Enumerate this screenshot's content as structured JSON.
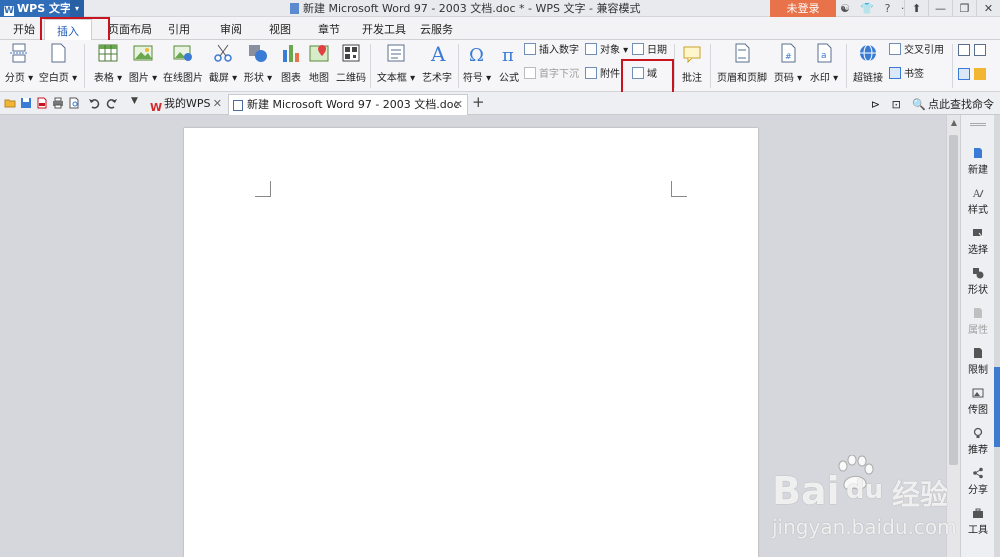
{
  "titlebar": {
    "app_name": "WPS 文字",
    "app_caret": "▾",
    "doc_title": "新建 Microsoft Word 97 - 2003 文档.doc * - WPS 文字 - 兼容模式",
    "login": "未登录",
    "tools": [
      "☯",
      "👕",
      "?",
      "·"
    ],
    "window_controls": [
      "⬆",
      "—",
      "❐",
      "✕"
    ]
  },
  "menu": {
    "tabs": [
      "开始",
      "插入",
      "页面布局",
      "引用",
      "审阅",
      "视图",
      "章节",
      "开发工具",
      "云服务"
    ],
    "active": "插入"
  },
  "ribbon": {
    "page_break": "分页 ▾",
    "blank_page": "空白页 ▾",
    "table": "表格 ▾",
    "picture": "图片 ▾",
    "online_picture": "在线图片",
    "screenshot": "截屏 ▾",
    "shapes": "形状 ▾",
    "chart": "图表",
    "map": "地图",
    "qrcode": "二维码",
    "textbox": "文本框 ▾",
    "wordart": "艺术字",
    "symbol": "符号 ▾",
    "formula": "公式",
    "insert_number": "插入数字",
    "drop_cap": "首字下沉",
    "object": "对象 ▾",
    "attachment": "附件",
    "date": "日期",
    "field": "域",
    "comment": "批注",
    "header_footer": "页眉和页脚",
    "page_number": "页码 ▾",
    "watermark": "水印 ▾",
    "hyperlink": "超链接",
    "cross_reference": "交叉引用",
    "bookmark": "书签"
  },
  "tabbar": {
    "tabs": [
      {
        "label": "我的WPS",
        "close": "✕"
      },
      {
        "label": "新建 Microsoft Word 97 - 2003 文档.doc *",
        "close": "✕"
      }
    ],
    "add": "+",
    "find_command": "点此查找命令"
  },
  "sidepanel": {
    "items": [
      "新建",
      "样式",
      "选择",
      "形状",
      "属性",
      "限制",
      "传图",
      "推荐",
      "分享",
      "工具"
    ]
  },
  "watermark": {
    "brand_latin": "Bai",
    "brand_du": "du",
    "brand_cn": "经验",
    "url": "jingyan.baidu.com"
  },
  "colors": {
    "app_blue": "#2f6db8",
    "login_orange": "#e8734a",
    "highlight_red": "#c8141e",
    "active_tab_text": "#1f5bb5"
  }
}
